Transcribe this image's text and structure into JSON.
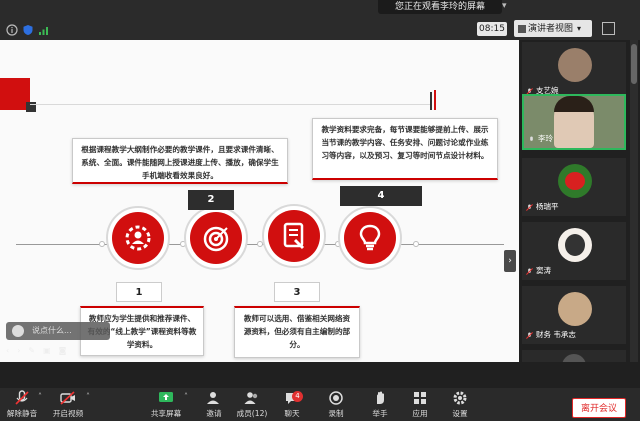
{
  "share_banner": "您正在观看李玲的屏幕",
  "time": "08:15",
  "view_button": "演讲者视图",
  "slide": {
    "notes": {
      "top_left": "根据课程教学大纲制作必要的教学课件，且要求课件清晰、系统、全面。课件能随网上授课进度上传、播放，确保学生手机端收看效果良好。",
      "top_right": "教学资料要求完备，每节课要能够提前上传、展示当节课的教学内容、任务安排、问题讨论或作业练习等内容，以及预习、复习等时间节点设计材料。",
      "bottom_left": "教师应为学生提供和推荐课件、有效的“线上教学”课程资料等教学资料。",
      "bottom_right": "教师可以选用、借鉴相关网络资源资料，但必须有自主编制的部分。"
    },
    "numbers": [
      "1",
      "2",
      "3",
      "4"
    ]
  },
  "chat_placeholder": "说点什么...",
  "participants": [
    {
      "name": "支艺婉"
    },
    {
      "name": "李玲"
    },
    {
      "name": "杨瑞平"
    },
    {
      "name": "窦涛"
    },
    {
      "name": "财务 韦承志"
    },
    {
      "name": ""
    }
  ],
  "toolbar": {
    "mute": "解除静音",
    "video": "开启视频",
    "share": "共享屏幕",
    "invite": "邀请",
    "members": "成员(12)",
    "chat": "聊天",
    "chat_badge": "4",
    "record": "录制",
    "raise_hand": "举手",
    "apps": "应用",
    "settings": "设置",
    "leave": "离开会议"
  }
}
